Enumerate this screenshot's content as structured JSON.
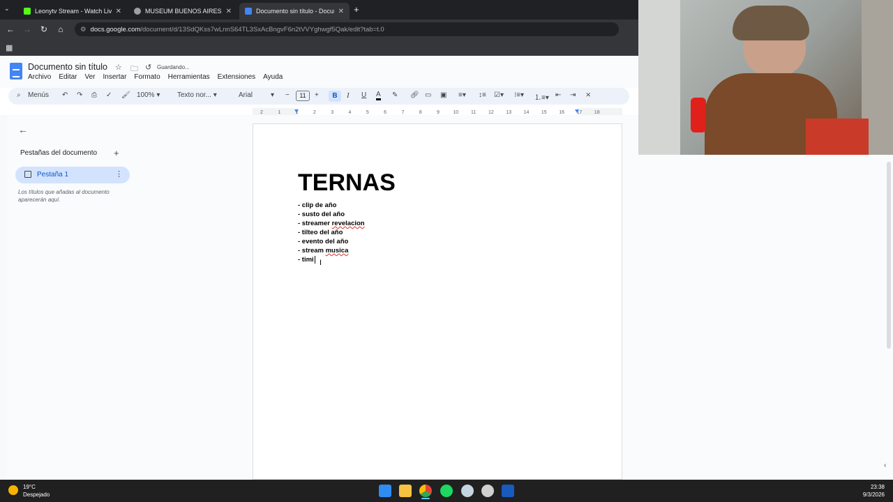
{
  "browser": {
    "tabs": [
      {
        "title": "Leonytv Stream - Watch Live o",
        "favicon_color": "#53fc18"
      },
      {
        "title": "MUSEUM BUENOS AIRES VACI",
        "favicon_color": "#9aa0a6"
      },
      {
        "title": "Documento sin título - Docum",
        "favicon_color": "#4285f4"
      }
    ],
    "url_host": "docs.google.com",
    "url_path": "/document/d/13SdQKss7wLnnS64TL3SxAcBngvF6n2tVVYghwgf5Qak/edit?tab=t.0"
  },
  "docs": {
    "title": "Documento sin título",
    "saving_status": "Guardando...",
    "menu": [
      "Archivo",
      "Editar",
      "Ver",
      "Insertar",
      "Formato",
      "Herramientas",
      "Extensiones",
      "Ayuda"
    ],
    "toolbar": {
      "search_menus": "Menús",
      "zoom": "100%",
      "style": "Texto nor...",
      "font": "Arial",
      "font_size": "11",
      "bold": "B",
      "italic": "I",
      "underline": "U",
      "text_color": "A"
    },
    "ruler_numbers": [
      "2",
      "1",
      "1",
      "2",
      "3",
      "4",
      "5",
      "6",
      "7",
      "8",
      "9",
      "10",
      "11",
      "12",
      "13",
      "14",
      "15",
      "16",
      "17",
      "18"
    ],
    "side_panel": {
      "header": "Pestañas del documento",
      "tab_label": "Pestaña 1",
      "hint": "Los títulos que añadas al documento aparecerán aquí."
    },
    "content": {
      "heading": "TERNAS",
      "lines": [
        {
          "prefix": "- clip de año",
          "flagged": ""
        },
        {
          "prefix": "- susto del año",
          "flagged": ""
        },
        {
          "prefix": "- streamer ",
          "flagged": "revelacion"
        },
        {
          "prefix": "- tilteo del año",
          "flagged": ""
        },
        {
          "prefix": "- evento del año",
          "flagged": ""
        },
        {
          "prefix": "- stream ",
          "flagged": "musica"
        },
        {
          "prefix": "- timi",
          "flagged": ""
        }
      ]
    }
  },
  "taskbar": {
    "temperature": "19°C",
    "weather": "Despejado",
    "time": "23:38",
    "date": "9/3/2026",
    "apps": [
      {
        "name": "windows-start",
        "color": "#2f8cf3"
      },
      {
        "name": "file-explorer",
        "color": "#f5c242"
      },
      {
        "name": "chrome",
        "color": "#e94235"
      },
      {
        "name": "spotify",
        "color": "#1ed760"
      },
      {
        "name": "steam",
        "color": "#c7d5e0"
      },
      {
        "name": "obs",
        "color": "#d0d0d0"
      },
      {
        "name": "word",
        "color": "#185abd"
      }
    ]
  }
}
